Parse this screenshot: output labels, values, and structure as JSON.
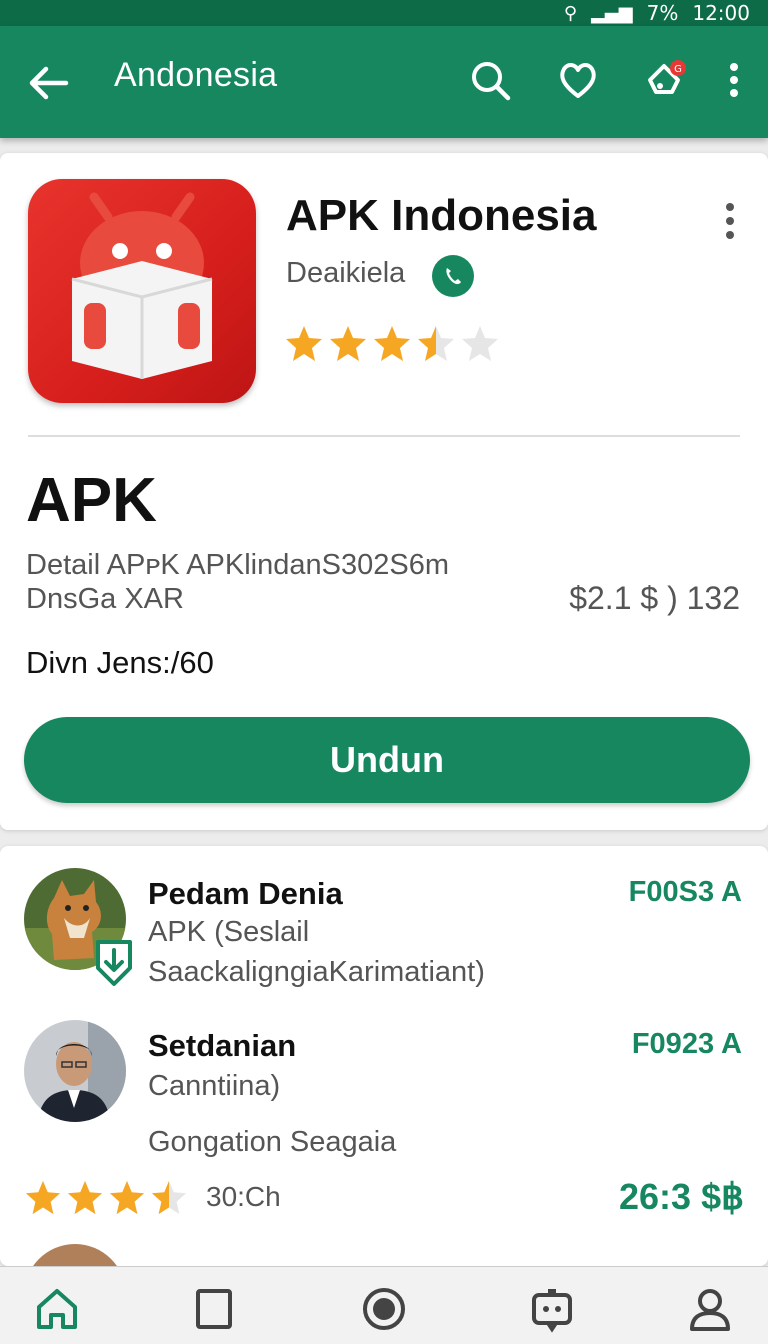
{
  "status_bar": {
    "percent": "7",
    "time": "12:00"
  },
  "app_bar": {
    "title": "Andonesia"
  },
  "app": {
    "name": "APK Indonesia",
    "developer": "Deaikiela",
    "rating": 3.5,
    "section_title": "APK",
    "detail_line1": "Detail APᴘK APKlindanS302S6m",
    "detail_line2": "DnsGa XAR",
    "price": "$2.1 $ ) 132",
    "downloads": "Divn Jens:/60",
    "download_button": "Undun"
  },
  "list": [
    {
      "name": "Pedam Denia",
      "line1": "APK (Seslail",
      "line2": "SaackaligngiaKarimatiant)",
      "code": "F00S3 A"
    },
    {
      "name": "Setdanian",
      "line1": "Canntiina)",
      "line2": "Gongation Seagaia",
      "code": "F0923 A",
      "rating": 3.5,
      "time": "30:Ch",
      "big_value": "26:3 $฿"
    }
  ],
  "colors": {
    "primary": "#178760",
    "status_bar": "#0d6b48",
    "app_icon": "#e02a26",
    "star": "#f5a623"
  },
  "icons": [
    "back-arrow-icon",
    "search-icon",
    "heart-icon",
    "notification-icon",
    "more-vert-icon",
    "home-icon",
    "square-icon",
    "record-icon",
    "chat-icon",
    "profile-icon",
    "verified-icon"
  ]
}
